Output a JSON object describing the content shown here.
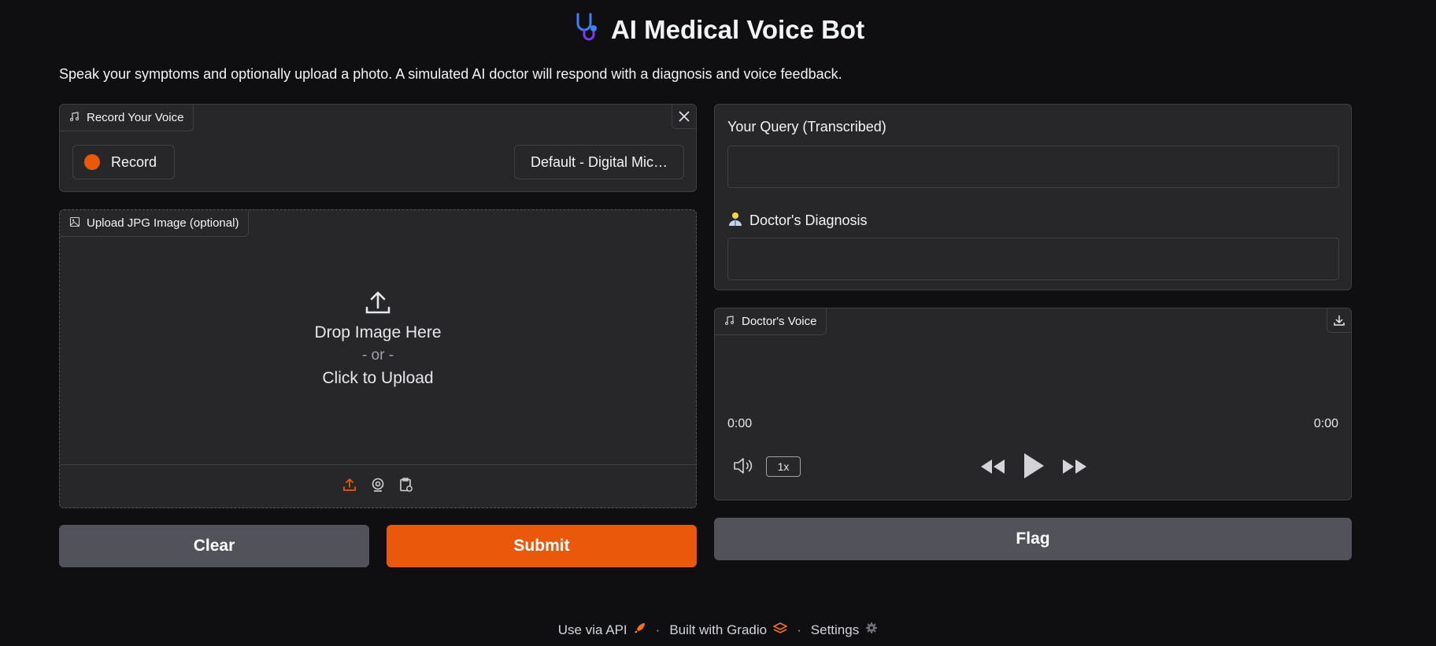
{
  "header": {
    "title": "AI Medical Voice Bot",
    "subtitle": "Speak your symptoms and optionally upload a photo. A simulated AI doctor will respond with a diagnosis and voice feedback."
  },
  "record_panel": {
    "label": "Record Your Voice",
    "record_label": "Record",
    "mic_device": "Default - Digital Mic…"
  },
  "upload_panel": {
    "label": "Upload JPG Image (optional)",
    "drop_text": "Drop Image Here",
    "or_text": "- or -",
    "click_text": "Click to Upload"
  },
  "actions": {
    "clear_label": "Clear",
    "submit_label": "Submit",
    "flag_label": "Flag"
  },
  "output": {
    "query_label": "Your Query (Transcribed)",
    "query_value": "",
    "diagnosis_label": "Doctor's Diagnosis",
    "diagnosis_value": ""
  },
  "audio_player": {
    "label": "Doctor's Voice",
    "current_time": "0:00",
    "duration": "0:00",
    "speed": "1x"
  },
  "footer": {
    "api_label": "Use via API",
    "built_label": "Built with Gradio",
    "settings_label": "Settings"
  },
  "colors": {
    "accent": "#ea580c",
    "background": "#0f0f11",
    "panel": "#27272a",
    "secondary_button": "#52525b"
  }
}
